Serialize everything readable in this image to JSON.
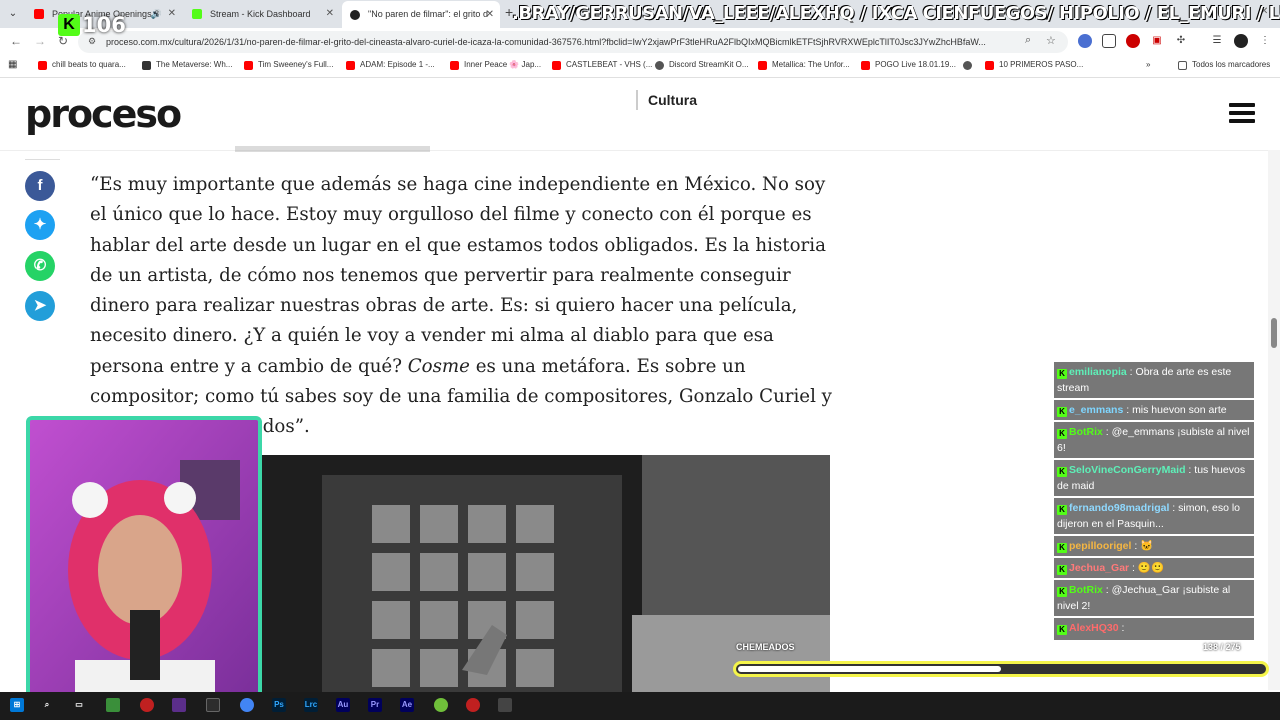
{
  "browser": {
    "tabs": [
      {
        "title": "Popular Anime Openings 8",
        "active": false,
        "audio": true
      },
      {
        "title": "Stream - Kick Dashboard",
        "active": false,
        "audio": false
      },
      {
        "title": "\"No paren de filmar\": el grito d",
        "active": true,
        "audio": false
      }
    ],
    "new_tab": "+",
    "url": "proceso.com.mx/cultura/2026/1/31/no-paren-de-filmar-el-grito-del-cineasta-alvaro-curiel-de-icaza-la-comunidad-367576.html?fbclid=IwY2xjawPrF3tleHRuA2FlbQIxMQBicmlkETFtSjhRVRXWEplcTlIT0Jsc3JYwZhcHBfaW...",
    "bookmarks": [
      {
        "label": "chill beats to quara...",
        "color": "#ff0000"
      },
      {
        "label": "The Metaverse: Wh...",
        "color": "#333333"
      },
      {
        "label": "Tim Sweeney's Full...",
        "color": "#ff0000"
      },
      {
        "label": "ADAM: Episode 1 -...",
        "color": "#ff0000"
      },
      {
        "label": "Inner Peace 🌸 Jap...",
        "color": "#ff0000"
      },
      {
        "label": "CASTLEBEAT - VHS (...",
        "color": "#ff0000"
      },
      {
        "label": "Discord StreamKit O...",
        "color": "#555555"
      },
      {
        "label": "Metallica: The Unfor...",
        "color": "#ff0000"
      },
      {
        "label": "POGO Live 18.01.19...",
        "color": "#ff0000"
      },
      {
        "label": "",
        "color": "#555555"
      },
      {
        "label": "10 PRIMEROS PASO...",
        "color": "#ff0000"
      }
    ],
    "all_bookmarks": "Todos los marcadores"
  },
  "site": {
    "logo": "proceso",
    "section": "Cultura"
  },
  "article": {
    "part1": "“Es muy importante que además se haga cine independiente en México. No soy el único que lo hace. Estoy muy orgulloso del filme y conecto con él porque es hablar del arte desde un lugar en el que estamos todos obligados. Es la historia de un artista, de cómo nos tenemos que pervertir para realmente conseguir dinero para realizar nuestras obras de arte. Es: si quiero hacer una película, necesito dinero. ¿Y a quién le voy a vender mi alma al diablo para que esa persona entre y a cambio de qué? ",
    "italic": "Cosme",
    "part2": " es una metáfora. Es sobre un compositor; como tú sabes soy de una familia de compositores, Gonzalo Curiel y Federico Curiel, todos”."
  },
  "stream": {
    "viewer_count": "106",
    "goal_label": "CHEMEADOS",
    "goal_count": "138 / 275",
    "goal_progress": 0.5,
    "ticker": ".BRAY/GERRUSAN/VA_LEEE/ALEXHQ / IXCA CIENFUEGOS/ HIPOLIO / EL_EMURI / LUISSPV/YEYOT"
  },
  "chat": [
    {
      "user": "emilianopia",
      "color": "#5ef0b8",
      "text": "Obra de arte es este stream"
    },
    {
      "user": "e_emmans",
      "color": "#7fd6ff",
      "text": "mis huevon son arte"
    },
    {
      "user": "BotRix",
      "color": "#53fc18",
      "text": "@e_emmans ¡subiste al nivel 6!"
    },
    {
      "user": "SeloVineConGerryMaid",
      "color": "#5ef0b8",
      "text": "tus huevos de maid"
    },
    {
      "user": "fernando98madrigal",
      "color": "#8fd9ff",
      "text": "simon, eso lo dijeron en el Pasquin..."
    },
    {
      "user": "pepilloorigel",
      "color": "#f5b642",
      "text": ""
    },
    {
      "user": "Jechua_Gar",
      "color": "#ff7a7a",
      "text": ""
    },
    {
      "user": "BotRix",
      "color": "#53fc18",
      "text": "@Jechua_Gar ¡subiste al nivel 2!"
    },
    {
      "user": "AlexHQ30",
      "color": "#ff6b6b",
      "text": ""
    }
  ]
}
